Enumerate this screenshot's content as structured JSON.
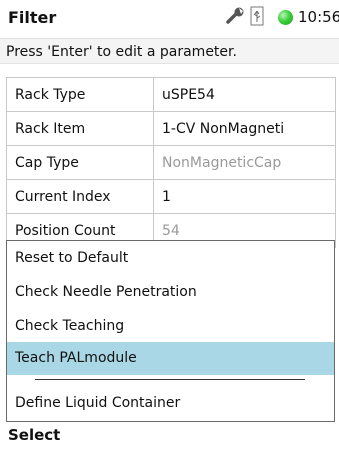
{
  "header": {
    "title": "Filter",
    "time": "10:56",
    "icons": [
      "wrench-icon",
      "usb-icon",
      "status-led-icon"
    ],
    "status_color": "#3bd13b"
  },
  "instruction": "Press 'Enter' to edit a parameter.",
  "params": [
    {
      "label": "Rack Type",
      "value": "uSPE54"
    },
    {
      "label": "Rack Item",
      "value": "1-CV NonMagneti"
    },
    {
      "label": "Cap Type",
      "value": "NonMagneticCap",
      "disabled": true
    },
    {
      "label": "Current Index",
      "value": "1"
    },
    {
      "label": "Position Count",
      "value": "54",
      "disabled": true
    }
  ],
  "menu": {
    "items": [
      "Reset to Default",
      "Check Needle Penetration",
      "Check Teaching",
      "Teach PALmodule",
      "Define Liquid Container"
    ],
    "selected": "Teach PALmodule",
    "highlight_color": "#a9d7e6"
  },
  "footer": {
    "soft_key": "Select"
  }
}
